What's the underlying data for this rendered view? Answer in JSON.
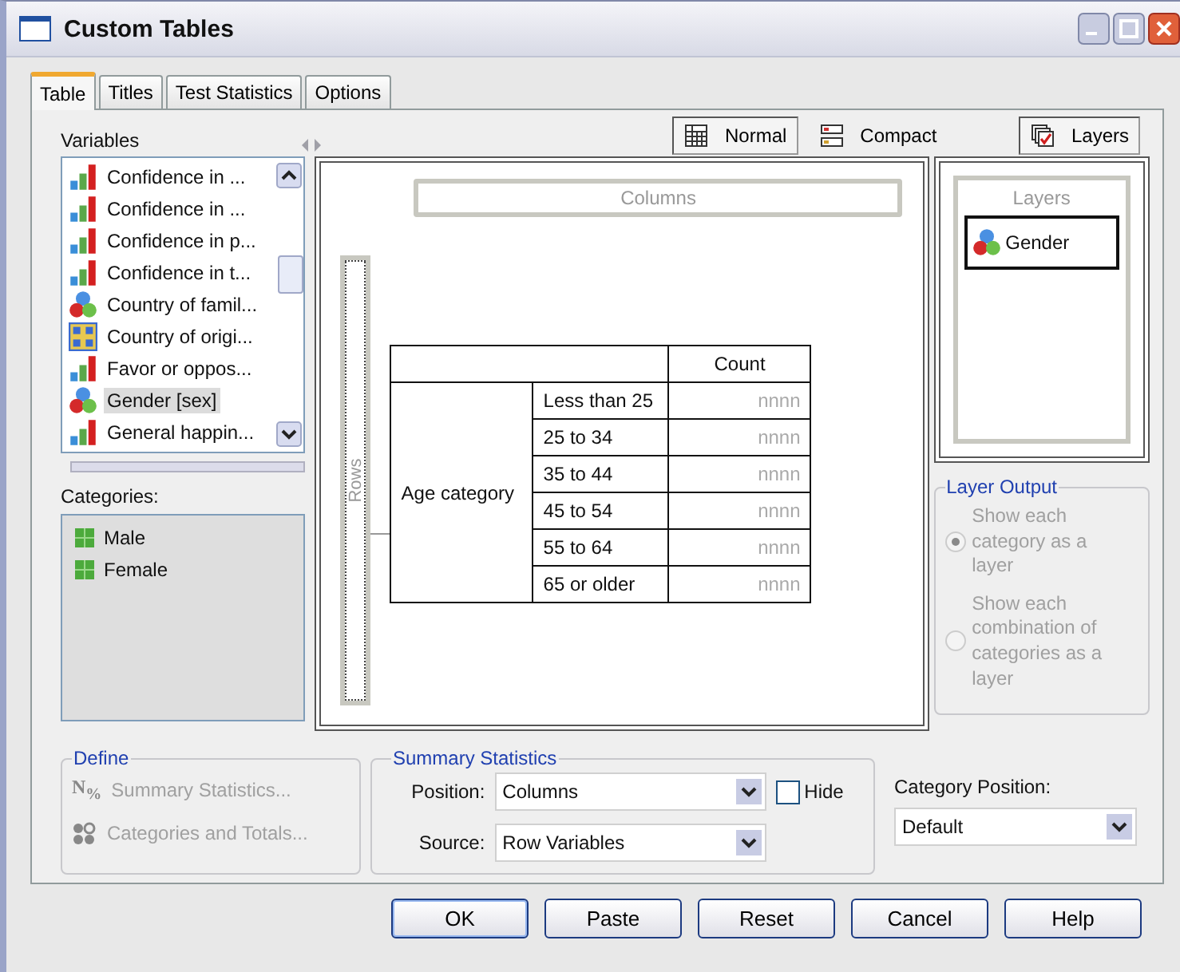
{
  "window": {
    "title": "Custom Tables"
  },
  "tabs": [
    {
      "label": "Table",
      "selected": true
    },
    {
      "label": "Titles",
      "selected": false
    },
    {
      "label": "Test Statistics",
      "selected": false
    },
    {
      "label": "Options",
      "selected": false
    }
  ],
  "variables": {
    "label": "Variables",
    "items": [
      {
        "name": "Confidence in ...",
        "kind": "bars",
        "selected": false
      },
      {
        "name": "Confidence in ...",
        "kind": "bars",
        "selected": false
      },
      {
        "name": "Confidence in p...",
        "kind": "bars",
        "selected": false
      },
      {
        "name": "Confidence in t...",
        "kind": "bars",
        "selected": false
      },
      {
        "name": "Country of famil...",
        "kind": "circles",
        "selected": false
      },
      {
        "name": "Country of origi...",
        "kind": "grid",
        "selected": false
      },
      {
        "name": "Favor or oppos...",
        "kind": "bars",
        "selected": false
      },
      {
        "name": "Gender [sex]",
        "kind": "circles",
        "selected": true
      },
      {
        "name": "General happin...",
        "kind": "bars",
        "selected": false
      }
    ]
  },
  "categories": {
    "label": "Categories:",
    "items": [
      "Male",
      "Female"
    ]
  },
  "view_buttons": [
    {
      "label": "Normal",
      "kind": "normal",
      "selected": true
    },
    {
      "label": "Compact",
      "kind": "compact",
      "selected": false
    }
  ],
  "layers_button": {
    "label": "Layers",
    "selected": true
  },
  "canvas": {
    "columns_label": "Columns",
    "rows_label": "Rows",
    "column_header": "Count",
    "row_variable": "Age category",
    "rows": [
      {
        "label": "Less than 25",
        "value": "nnnn"
      },
      {
        "label": "25 to 34",
        "value": "nnnn"
      },
      {
        "label": "35 to 44",
        "value": "nnnn"
      },
      {
        "label": "45 to 54",
        "value": "nnnn"
      },
      {
        "label": "55 to 64",
        "value": "nnnn"
      },
      {
        "label": "65 or older",
        "value": "nnnn"
      }
    ]
  },
  "layers": {
    "title": "Layers",
    "items": [
      "Gender"
    ]
  },
  "layer_output": {
    "legend": "Layer Output",
    "options": [
      {
        "label": "Show each category as a layer",
        "selected": true,
        "disabled": true
      },
      {
        "label": "Show each combination of categories as a layer",
        "selected": false,
        "disabled": true
      }
    ]
  },
  "define": {
    "legend": "Define",
    "buttons": [
      {
        "label": "Summary Statistics...",
        "kind": "stats",
        "icon": "N$_{%}$",
        "disabled": true
      },
      {
        "label": "Categories and Totals...",
        "kind": "totals",
        "disabled": true
      }
    ]
  },
  "summary_statistics": {
    "legend": "Summary Statistics",
    "position_label": "Position:",
    "position_value": "Columns",
    "source_label": "Source:",
    "source_value": "Row Variables",
    "hide": {
      "label": "Hide",
      "checked": false
    }
  },
  "category_position": {
    "label": "Category Position:",
    "value": "Default"
  },
  "buttons": [
    {
      "label": "OK",
      "default": true
    },
    {
      "label": "Paste",
      "default": false
    },
    {
      "label": "Reset",
      "default": false
    },
    {
      "label": "Cancel",
      "default": false
    },
    {
      "label": "Help",
      "default": false
    }
  ]
}
